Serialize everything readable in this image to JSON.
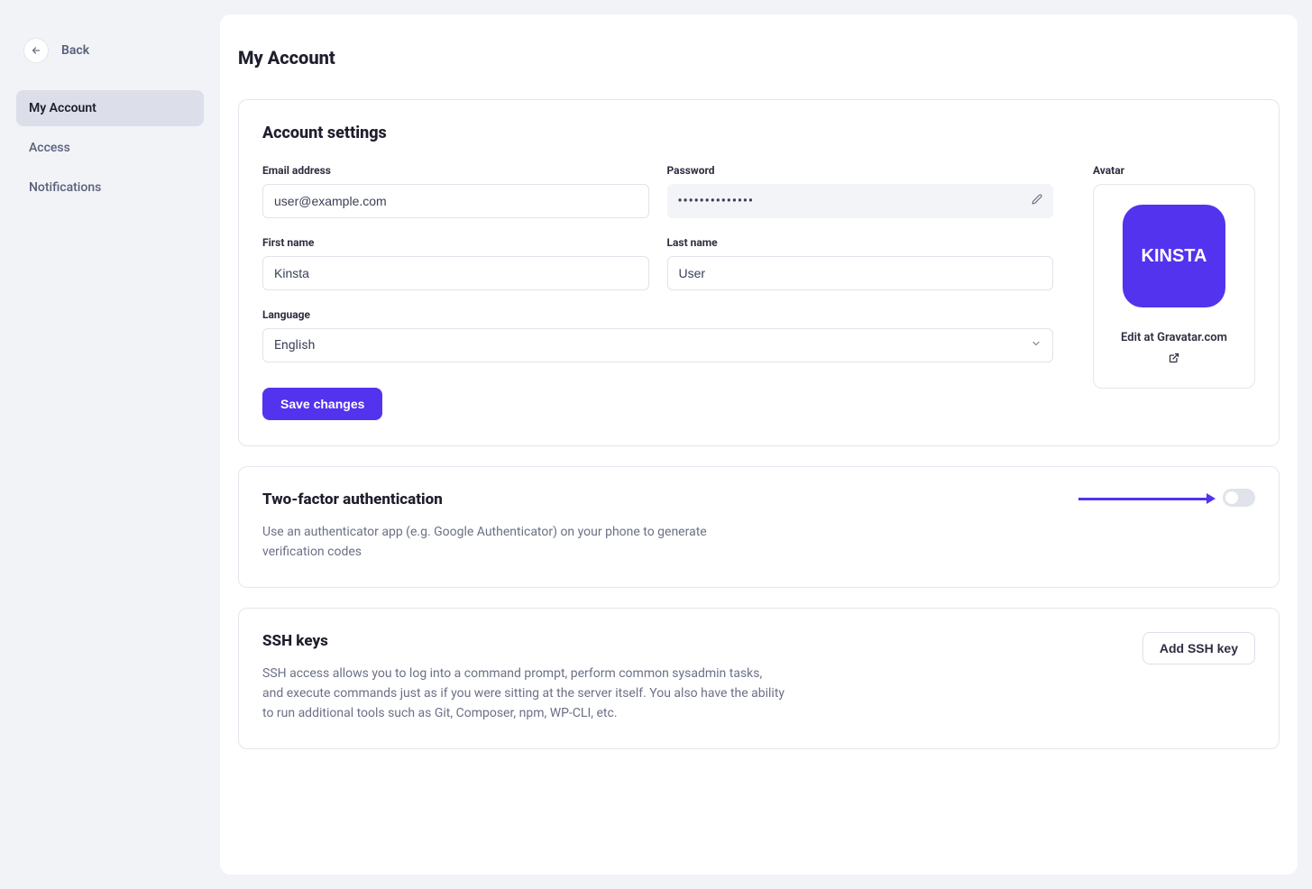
{
  "back": {
    "label": "Back"
  },
  "sidebar": {
    "items": [
      {
        "label": "My Account",
        "active": true
      },
      {
        "label": "Access",
        "active": false
      },
      {
        "label": "Notifications",
        "active": false
      }
    ]
  },
  "page": {
    "title": "My Account"
  },
  "account_settings": {
    "title": "Account settings",
    "email_label": "Email address",
    "email_value": "user@example.com",
    "password_label": "Password",
    "password_mask": "••••••••••••••",
    "first_name_label": "First name",
    "first_name_value": "Kinsta",
    "last_name_label": "Last name",
    "last_name_value": "User",
    "language_label": "Language",
    "language_value": "English",
    "save_label": "Save changes",
    "avatar_label": "Avatar",
    "avatar_brand": "KINSTA",
    "gravatar_text": "Edit at Gravatar.com"
  },
  "twofa": {
    "title": "Two-factor authentication",
    "description": "Use an authenticator app (e.g. Google Authenticator) on your phone to generate verification codes"
  },
  "ssh": {
    "title": "SSH keys",
    "description": "SSH access allows you to log into a command prompt, perform common sysadmin tasks, and execute commands just as if you were sitting at the server itself. You also have the ability to run additional tools such as Git, Composer, npm, WP-CLI, etc.",
    "button_label": "Add SSH key"
  },
  "colors": {
    "accent": "#5333ed",
    "bg": "#f1f3f7"
  }
}
